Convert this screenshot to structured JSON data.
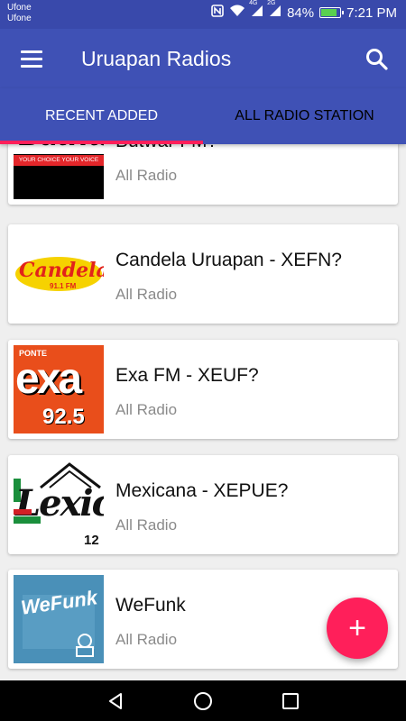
{
  "status_bar": {
    "carrier_1": "Ufone",
    "carrier_2": "Ufone",
    "network_1": "4G",
    "network_2": "2G",
    "battery": "84%",
    "battery_level": 0.84,
    "time": "7:21 PM"
  },
  "app_bar": {
    "title": "Uruapan Radios",
    "menu_icon": "hamburger-menu-icon",
    "search_icon": "search-icon"
  },
  "tabs": [
    {
      "label": "RECENT ADDED",
      "active": true
    },
    {
      "label": "ALL RADIO STATION",
      "active": false
    }
  ],
  "stations": [
    {
      "title": "Butwar FM?",
      "subtitle": "All Radio",
      "logo_text": "Butwar",
      "logo_tagline": "YOUR CHOICE YOUR VOICE"
    },
    {
      "title": "Candela Uruapan - XEFN?",
      "subtitle": "All Radio",
      "logo_text": "Candela",
      "logo_freq": "91.1 FM"
    },
    {
      "title": "Exa FM - XEUF?",
      "subtitle": "All Radio",
      "logo_text": "exa",
      "logo_top": "PONTE",
      "logo_freq": "92.5"
    },
    {
      "title": "Mexicana - XEPUE?",
      "subtitle": "All Radio",
      "logo_text": "Lexic",
      "logo_freq": "12"
    },
    {
      "title": "WeFunk",
      "subtitle": "All Radio",
      "logo_text": "WeFunk"
    }
  ],
  "fab": {
    "label": "+",
    "icon": "add-icon"
  },
  "nav": {
    "back_icon": "back-icon",
    "home_icon": "home-icon",
    "recents_icon": "recents-icon"
  },
  "colors": {
    "primary": "#3f51b5",
    "status": "#3949ab",
    "accent": "#ff1f5a"
  }
}
